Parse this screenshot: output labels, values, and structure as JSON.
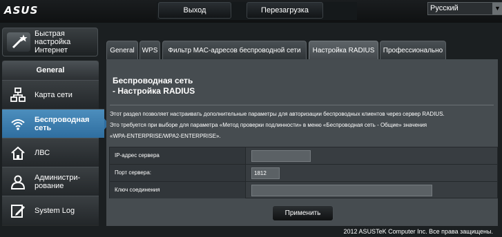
{
  "header": {
    "logo": "ASUS",
    "logout_label": "Выход",
    "reboot_label": "Перезагрузка",
    "language": "Русский"
  },
  "sidebar": {
    "quick_setup": [
      "Быстрая",
      "настройка",
      "Интернет"
    ],
    "section_title": "General",
    "items": [
      {
        "label": "Карта сети",
        "icon": "network-map-icon"
      },
      {
        "label": "Беспроводная сеть",
        "icon": "wireless-icon"
      },
      {
        "label": "ЛВС",
        "icon": "lan-home-icon"
      },
      {
        "label": "Администри-рование",
        "icon": "admin-person-icon"
      },
      {
        "label": "System Log",
        "icon": "system-log-icon"
      }
    ]
  },
  "tabs": [
    {
      "label": "General"
    },
    {
      "label": "WPS"
    },
    {
      "label": "Фильтр MAC-адресов беспроводной сети"
    },
    {
      "label": "Настройка RADIUS"
    },
    {
      "label": "Профессионально"
    }
  ],
  "main": {
    "title_line1": "Беспроводная сеть",
    "title_line2": "- Настройка RADIUS",
    "desc_line1": "Этот раздел позволяет настраивать дополнительные параметры для авторизации беспроводных клиентов через сервер RADIUS.",
    "desc_line2": "Это требуется при выборе для параметра «Метод проверки подлинности» в меню «Беспроводная сеть - Общие» значения",
    "desc_line3": "«WPA-ENTERPRISE/WPA2-ENTERPRISE».",
    "fields": [
      {
        "label": "IP-адрес сервера",
        "value": ""
      },
      {
        "label": "Порт сервера:",
        "value": "1812"
      },
      {
        "label": "Ключ соединения",
        "value": ""
      }
    ],
    "apply_label": "Применить"
  },
  "footer": "2012 ASUSTeK Computer Inc. Все права защищены.",
  "colors": {
    "accent": "#2f6ea0",
    "panel": "#464c50",
    "background": "#1b1f21"
  }
}
